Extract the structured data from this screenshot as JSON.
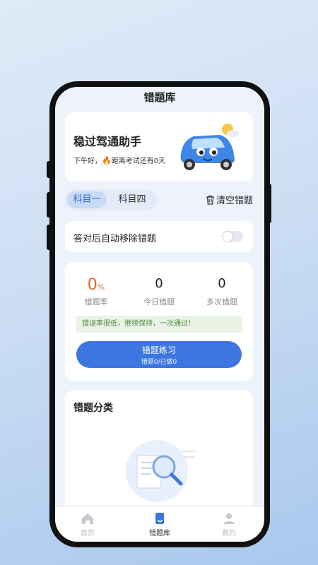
{
  "header": {
    "title": "错题库"
  },
  "hero": {
    "title": "稳过驾通助手",
    "greeting": "下午好，",
    "fire_icon": "🔥",
    "countdown": "距离考试还有0天"
  },
  "subject_tabs": [
    {
      "label": "科目一",
      "active": true
    },
    {
      "label": "科目四",
      "active": false
    }
  ],
  "clear_action": {
    "label": "清空错题",
    "icon": "trash-icon"
  },
  "auto_remove": {
    "label": "答对后自动移除错题",
    "enabled": false
  },
  "stats": [
    {
      "value": "0",
      "unit": "%",
      "label": "错题率"
    },
    {
      "value": "0",
      "label": "今日错题"
    },
    {
      "value": "0",
      "label": "多次错题"
    }
  ],
  "tip": "错误率很低，继续保持，一次通过！",
  "practice": {
    "label": "错题练习",
    "sub": "错题0/已做0"
  },
  "category": {
    "title": "错题分类"
  },
  "bottom_nav": [
    {
      "label": "首页",
      "icon": "home-icon",
      "active": false
    },
    {
      "label": "错题库",
      "icon": "book-icon",
      "active": true
    },
    {
      "label": "我的",
      "icon": "user-icon",
      "active": false
    }
  ],
  "colors": {
    "accent": "#3d76e0",
    "rate": "#e0672a",
    "tip_text": "#4a8a3a",
    "tip_bg": "#eaf3e6"
  }
}
